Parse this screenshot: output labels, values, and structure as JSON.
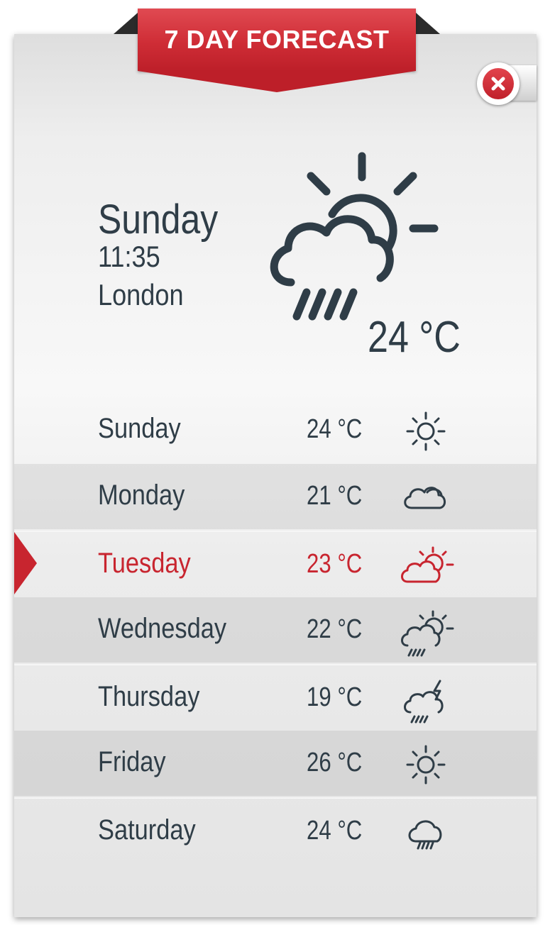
{
  "header": {
    "title": "7 DAY FORECAST"
  },
  "current": {
    "day": "Sunday",
    "time": "11:35",
    "city": "London",
    "temp": "24 °C",
    "icon": "sun-cloud-rain-icon"
  },
  "forecast": [
    {
      "day": "Sunday",
      "temp": "24 °C",
      "icon": "sun-icon"
    },
    {
      "day": "Monday",
      "temp": "21 °C",
      "icon": "cloud-icon"
    },
    {
      "day": "Tuesday",
      "temp": "23 °C",
      "icon": "partly-cloudy-icon",
      "selected": true
    },
    {
      "day": "Wednesday",
      "temp": "22 °C",
      "icon": "sun-cloud-rain-icon"
    },
    {
      "day": "Thursday",
      "temp": "19 °C",
      "icon": "thunderstorm-icon"
    },
    {
      "day": "Friday",
      "temp": "26 °C",
      "icon": "sun-icon"
    },
    {
      "day": "Saturday",
      "temp": "24 °C",
      "icon": "rain-icon"
    }
  ],
  "colors": {
    "accent": "#c8252f",
    "text": "#2f3d47"
  }
}
